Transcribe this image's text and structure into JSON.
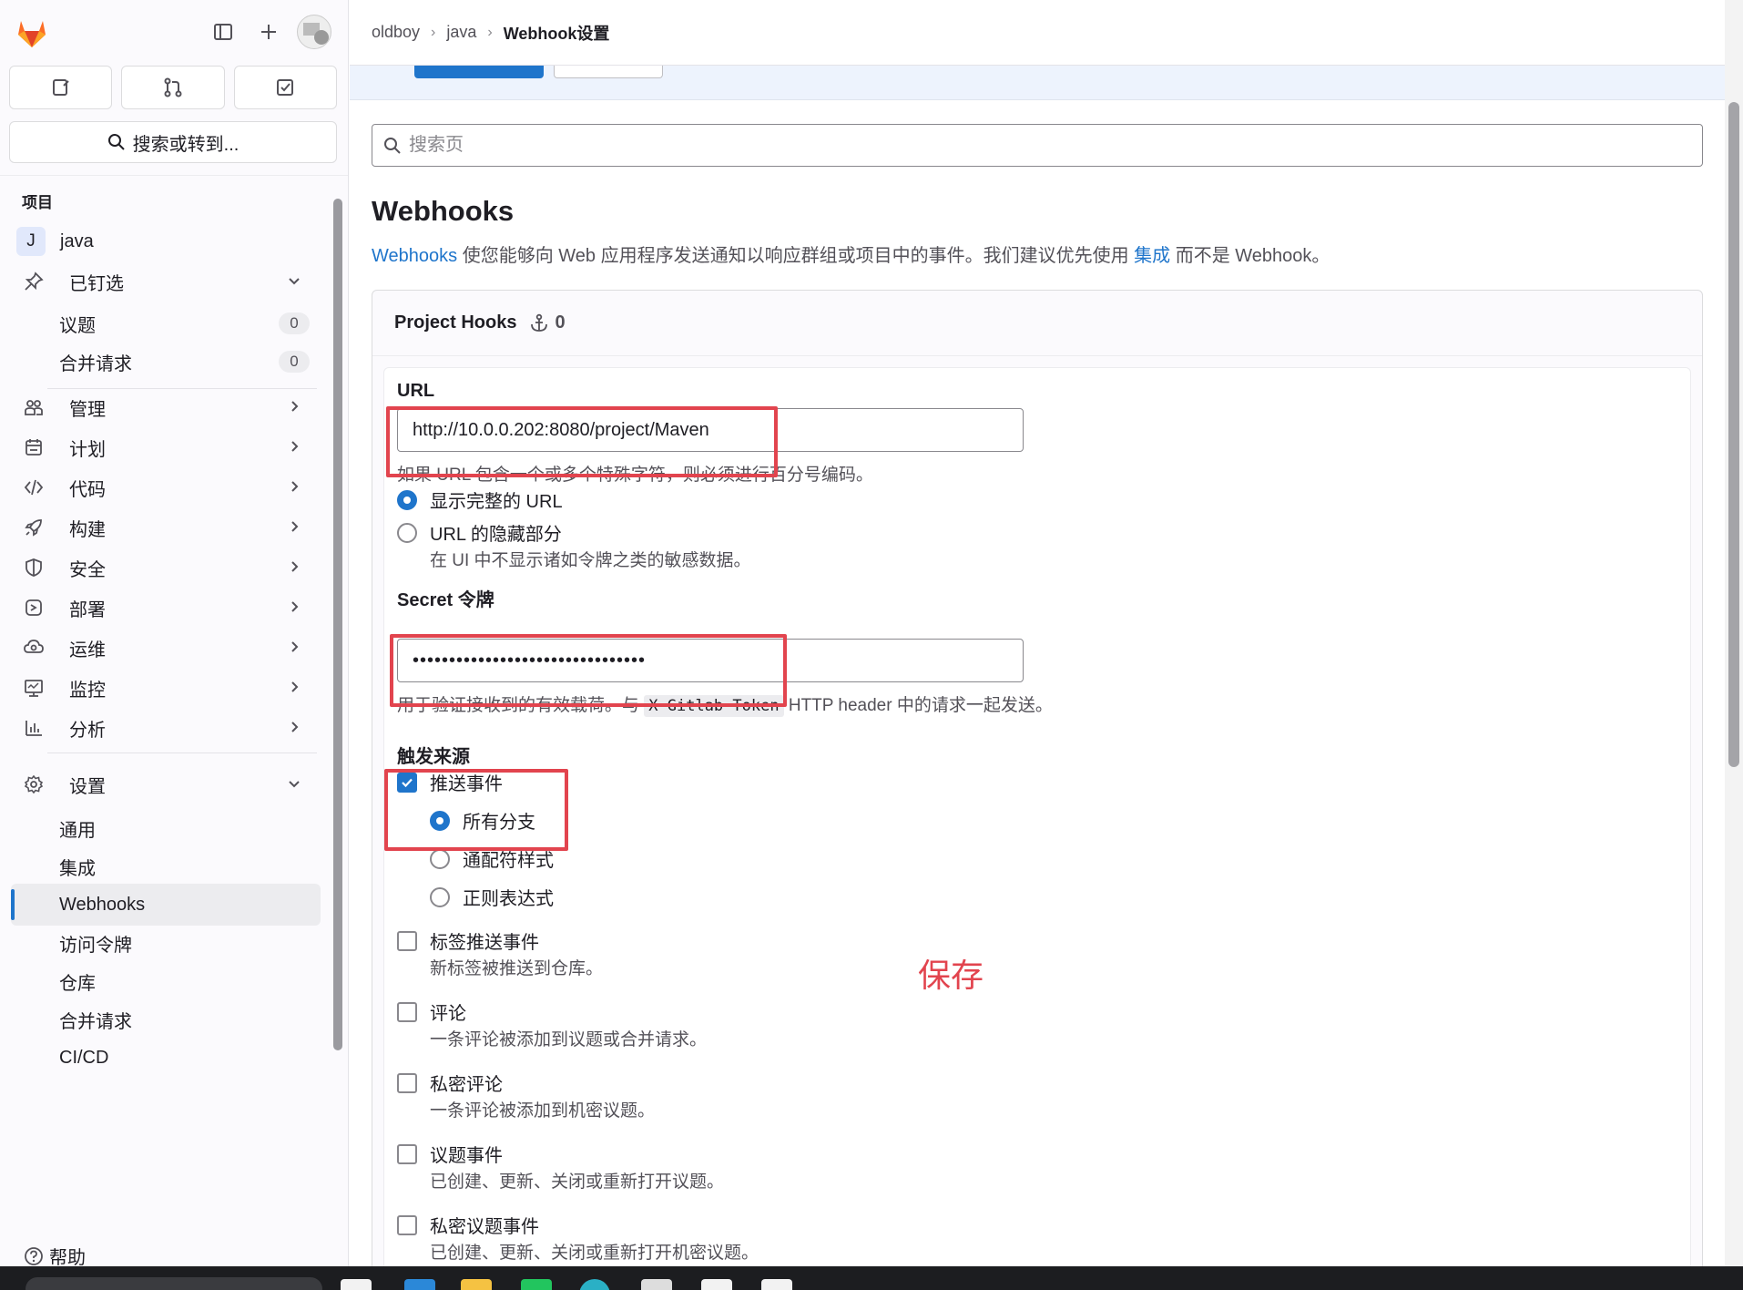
{
  "sidebar": {
    "search_label": "搜索或转到...",
    "section_label": "项目",
    "project": {
      "avatar_letter": "J",
      "name": "java"
    },
    "pinned": {
      "label": "已钉选",
      "items": [
        {
          "label": "议题",
          "count": "0"
        },
        {
          "label": "合并请求",
          "count": "0"
        }
      ]
    },
    "groups": [
      {
        "label": "管理",
        "icon": "users-icon"
      },
      {
        "label": "计划",
        "icon": "calendar-icon"
      },
      {
        "label": "代码",
        "icon": "code-icon"
      },
      {
        "label": "构建",
        "icon": "rocket-icon"
      },
      {
        "label": "安全",
        "icon": "shield-icon"
      },
      {
        "label": "部署",
        "icon": "deploy-icon"
      },
      {
        "label": "运维",
        "icon": "cloud-gear-icon"
      },
      {
        "label": "监控",
        "icon": "monitor-icon"
      },
      {
        "label": "分析",
        "icon": "chart-icon"
      }
    ],
    "settings": {
      "label": "设置",
      "items": [
        {
          "label": "通用"
        },
        {
          "label": "集成"
        },
        {
          "label": "Webhooks",
          "active": true
        },
        {
          "label": "访问令牌"
        },
        {
          "label": "仓库"
        },
        {
          "label": "合并请求"
        },
        {
          "label": "CI/CD"
        }
      ]
    },
    "help_label": "帮助"
  },
  "breadcrumb": {
    "items": [
      "oldboy",
      "java"
    ],
    "current": "Webhook设置"
  },
  "main": {
    "search_placeholder": "搜索页",
    "title": "Webhooks",
    "description": {
      "link1": "Webhooks",
      "text1": " 使您能够向 Web 应用程序发送通知以响应群组或项目中的事件。我们建议优先使用 ",
      "link2": "集成",
      "text2": " 而不是 Webhook。"
    },
    "card_title": "Project Hooks",
    "hooks_count": "0",
    "form": {
      "url_label": "URL",
      "url_value": "http://10.0.0.202:8080/project/Maven",
      "url_help": "如果 URL 包含一个或多个特殊字符，则必须进行百分号编码。",
      "url_display_options": [
        {
          "label": "显示完整的 URL",
          "selected": true
        },
        {
          "label": "URL 的隐藏部分",
          "selected": false,
          "desc": "在 UI 中不显示诸如令牌之类的敏感数据。"
        }
      ],
      "secret_label": "Secret 令牌",
      "secret_value": "••••••••••••••••••••••••••••••••",
      "secret_help_prefix": "用于验证接收到的有效载荷。与 ",
      "secret_help_code": "X-Gitlab-Token",
      "secret_help_suffix": " HTTP header 中的请求一起发送。",
      "trigger_label": "触发来源",
      "push_events": {
        "label": "推送事件",
        "checked": true,
        "branch_options": [
          {
            "label": "所有分支",
            "selected": true
          },
          {
            "label": "通配符样式",
            "selected": false
          },
          {
            "label": "正则表达式",
            "selected": false
          }
        ]
      },
      "events": [
        {
          "label": "标签推送事件",
          "desc": "新标签被推送到仓库。",
          "checked": false
        },
        {
          "label": "评论",
          "desc": "一条评论被添加到议题或合并请求。",
          "checked": false
        },
        {
          "label": "私密评论",
          "desc": "一条评论被添加到机密议题。",
          "checked": false
        },
        {
          "label": "议题事件",
          "desc": "已创建、更新、关闭或重新打开议题。",
          "checked": false
        },
        {
          "label": "私密议题事件",
          "desc": "已创建、更新、关闭或重新打开机密议题。",
          "checked": false
        }
      ]
    },
    "annotation_text": "保存"
  },
  "colors": {
    "accent": "#1f75cb",
    "annotation_red": "#e2444e",
    "sidebar_bg": "#fbfafd"
  }
}
